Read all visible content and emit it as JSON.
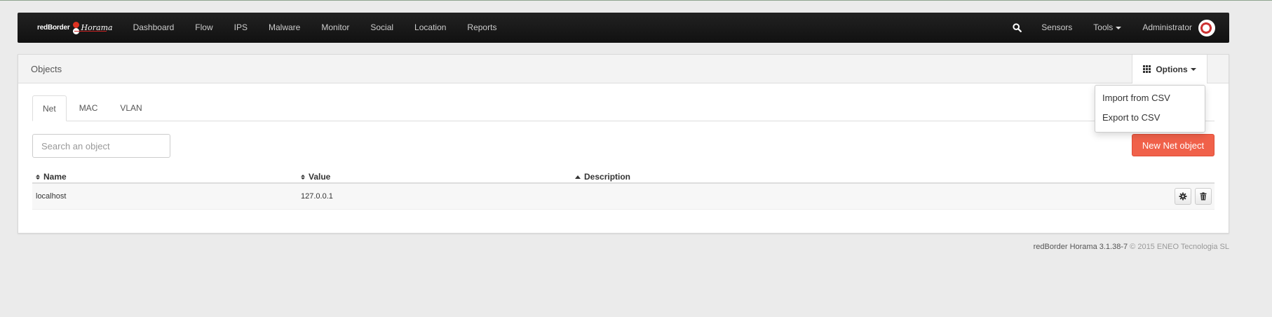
{
  "brand": {
    "part1": "redBorder",
    "part2": "Horama"
  },
  "nav": {
    "left": [
      "Dashboard",
      "Flow",
      "IPS",
      "Malware",
      "Monitor",
      "Social",
      "Location",
      "Reports"
    ],
    "sensors": "Sensors",
    "tools": "Tools",
    "user": "Administrator"
  },
  "panel": {
    "title": "Objects",
    "options_label": "Options",
    "options_menu": [
      "Import from CSV",
      "Export to CSV"
    ],
    "tabs": [
      "Net",
      "MAC",
      "VLAN"
    ],
    "active_tab": "Net",
    "search_placeholder": "Search an object",
    "new_button": "New Net object",
    "table": {
      "columns": [
        "Name",
        "Value",
        "Description"
      ],
      "rows": [
        {
          "name": "localhost",
          "value": "127.0.0.1",
          "description": ""
        }
      ]
    }
  },
  "footer": {
    "version": "redBorder Horama 3.1.38-7",
    "copyright": "© 2015 ENEO Tecnologia SL"
  },
  "colors": {
    "accent": "#f0614a",
    "navbar": "#161616",
    "brand_red": "#dd3322"
  }
}
